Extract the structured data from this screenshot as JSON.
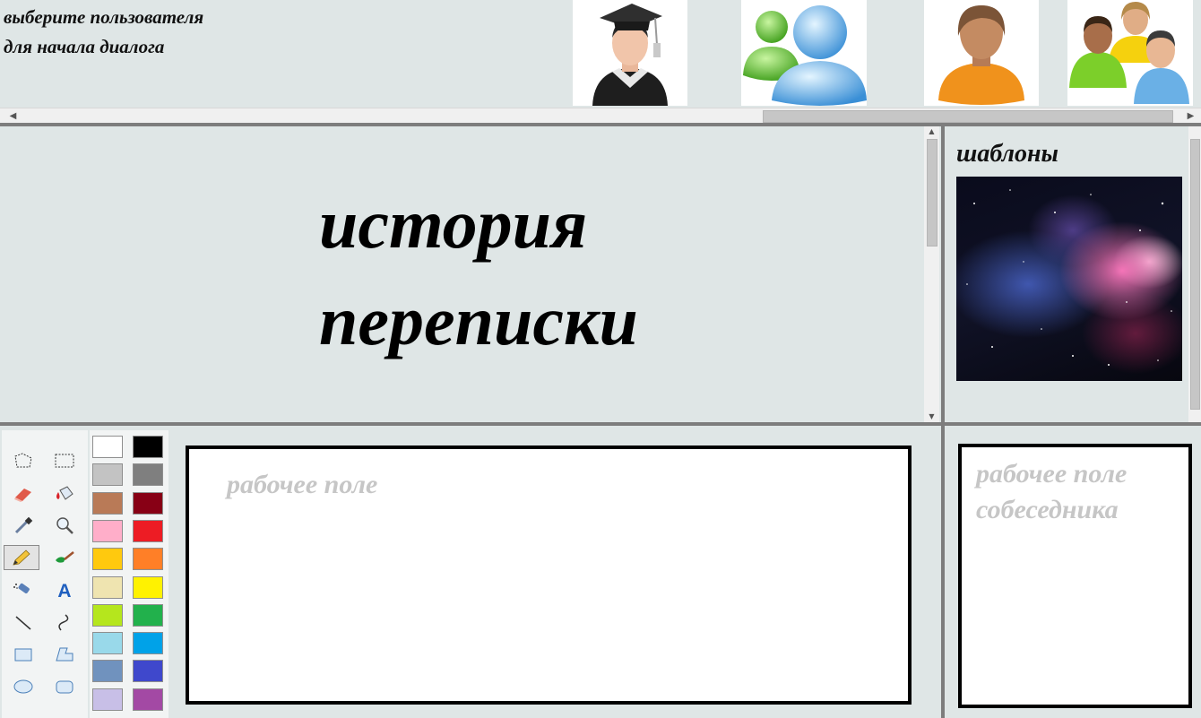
{
  "header": {
    "prompt_line1": "выберите пользователя",
    "prompt_line2": "для начала диалога"
  },
  "users": [
    {
      "icon": "graduate-avatar-icon"
    },
    {
      "icon": "messenger-contacts-icon"
    },
    {
      "icon": "person-avatar-icon"
    },
    {
      "icon": "user-group-icon"
    }
  ],
  "history": {
    "line1": "история",
    "line2": "переписки"
  },
  "templates": {
    "title": "шаблоны",
    "items": [
      {
        "icon": "space-nebula-image"
      }
    ]
  },
  "tools": [
    {
      "name": "free-select",
      "icon": "free-select-icon"
    },
    {
      "name": "rect-select",
      "icon": "rect-select-icon"
    },
    {
      "name": "eraser",
      "icon": "eraser-icon"
    },
    {
      "name": "fill",
      "icon": "fill-bucket-icon"
    },
    {
      "name": "color-picker",
      "icon": "eyedropper-icon"
    },
    {
      "name": "magnifier",
      "icon": "magnifier-icon"
    },
    {
      "name": "pencil",
      "icon": "pencil-icon",
      "active": true
    },
    {
      "name": "brush",
      "icon": "brush-icon"
    },
    {
      "name": "airbrush",
      "icon": "airbrush-icon"
    },
    {
      "name": "text",
      "icon": "text-icon",
      "glyph": "A"
    },
    {
      "name": "line",
      "icon": "line-icon"
    },
    {
      "name": "curve",
      "icon": "curve-icon"
    },
    {
      "name": "rectangle",
      "icon": "rectangle-icon"
    },
    {
      "name": "polygon",
      "icon": "polygon-icon"
    },
    {
      "name": "ellipse",
      "icon": "ellipse-icon"
    },
    {
      "name": "rounded-rectangle",
      "icon": "rounded-rect-icon"
    }
  ],
  "palette": {
    "colors": [
      "#ffffff",
      "#000000",
      "#c3c3c3",
      "#7f7f7f",
      "#b97a57",
      "#880015",
      "#ffaec9",
      "#ed1c24",
      "#ffc90e",
      "#ff7f27",
      "#efe4b0",
      "#fff200",
      "#b5e61d",
      "#22b14c",
      "#99d9ea",
      "#00a2e8",
      "#7092be",
      "#3f48cc",
      "#c8bfe7",
      "#a349a4"
    ]
  },
  "workspace": {
    "my_field_label": "рабочее поле",
    "partner_field_line1": "рабочее поле",
    "partner_field_line2": "собеседника"
  }
}
